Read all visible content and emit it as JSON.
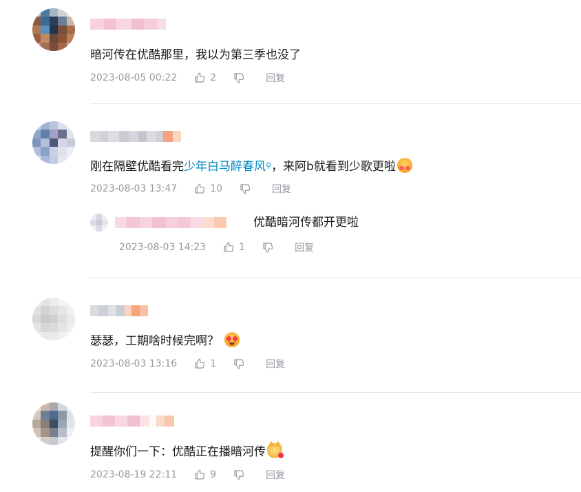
{
  "comments": [
    {
      "text": "暗河传在优酷那里，我以为第三季也没了",
      "time": "2023-08-05 00:22",
      "likes": "2",
      "reply_label": "回复"
    },
    {
      "text_before": "刚在隔壁优酷看完",
      "link_text": "少年白马醉春风",
      "text_after": "，来阿b就看到少歌更啦",
      "time": "2023-08-03 13:47",
      "likes": "10",
      "reply_label": "回复",
      "sub_reply": {
        "text": "优酷暗河传都开更啦",
        "time": "2023-08-03 14:23",
        "likes": "1",
        "reply_label": "回复"
      }
    },
    {
      "text": "瑟瑟，工期啥时候完啊？",
      "time": "2023-08-03 13:16",
      "likes": "1",
      "reply_label": "回复"
    },
    {
      "text": "提醒你们一下：优酷正在播暗河传",
      "time": "2023-08-19 22:11",
      "likes": "9",
      "reply_label": "回复"
    }
  ],
  "icons": {
    "like": "thumbs-up-icon",
    "dislike": "thumbs-down-icon",
    "search": "search-icon",
    "emoji_hug": "hugging-face-emoji",
    "emoji_heart_eyes": "heart-eyes-emoji",
    "emoji_cat": "cat-with-rose-emoji"
  },
  "colors": {
    "link": "#008ac5",
    "meta": "#9499a0",
    "divider": "#e3e5e7",
    "text": "#18191c"
  }
}
